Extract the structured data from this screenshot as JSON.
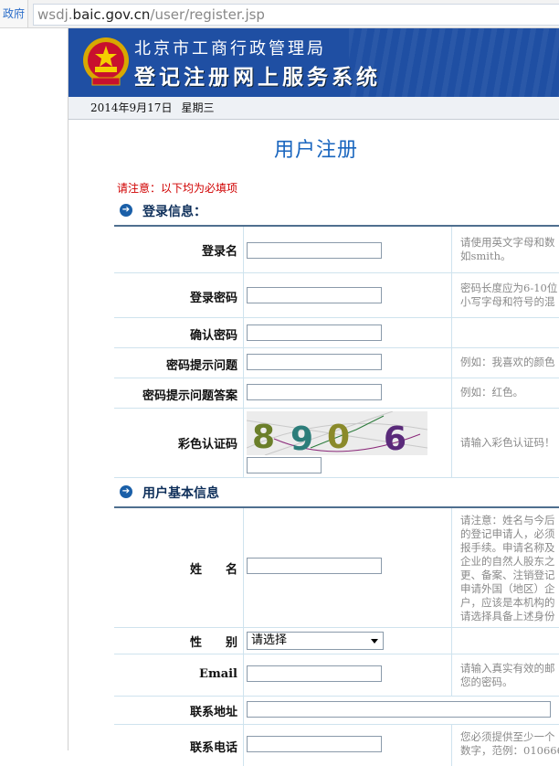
{
  "browser": {
    "left_tab": "政府",
    "url_prefix": "wsdj.",
    "url_host": "baic.gov.cn",
    "url_path": "/user/register.jsp"
  },
  "banner": {
    "line1": "北京市工商行政管理局",
    "line2": "登记注册网上服务系统"
  },
  "datebar": {
    "date": "2014年9月17日",
    "weekday": "星期三"
  },
  "page_title": "用户注册",
  "required_note": "请注意：以下均为必填项",
  "sections": {
    "login": "登录信息：",
    "basic": "用户基本信息"
  },
  "fields": {
    "username": {
      "label": "登录名",
      "tip1": "请使用英文字母和数",
      "tip2": "如smith。"
    },
    "password": {
      "label": "登录密码",
      "tip1": "密码长度应为6-10位",
      "tip2": "小写字母和符号的混"
    },
    "confirm": {
      "label": "确认密码"
    },
    "question": {
      "label": "密码提示问题",
      "tip1": "例如：我喜欢的颜色"
    },
    "answer": {
      "label": "密码提示问题答案",
      "tip1": "例如：红色。"
    },
    "captcha": {
      "label": "彩色认证码",
      "code": "8906",
      "tip1": "请输入彩色认证码！"
    },
    "name": {
      "label": "姓　　名",
      "tips": [
        "请注意：姓名与今后",
        "的登记申请人，必须",
        "报手续。申请名称及",
        "企业的自然人股东之",
        "更、备案、注销登记",
        "申请外国（地区）企",
        "户，应该是本机构的",
        "请选择具备上述身份"
      ]
    },
    "gender": {
      "label": "性　　别",
      "value": "请选择"
    },
    "email": {
      "label": "Email",
      "tip1": "请输入真实有效的邮",
      "tip2": "您的密码。"
    },
    "address": {
      "label": "联系地址"
    },
    "phone": {
      "label": "联系电话",
      "tip1": "您必须提供至少一个",
      "tip2": "数字，范例：010666"
    }
  },
  "colors": {
    "banner": "#1f4fa3",
    "title": "#1a66bf",
    "required": "#d00000"
  }
}
